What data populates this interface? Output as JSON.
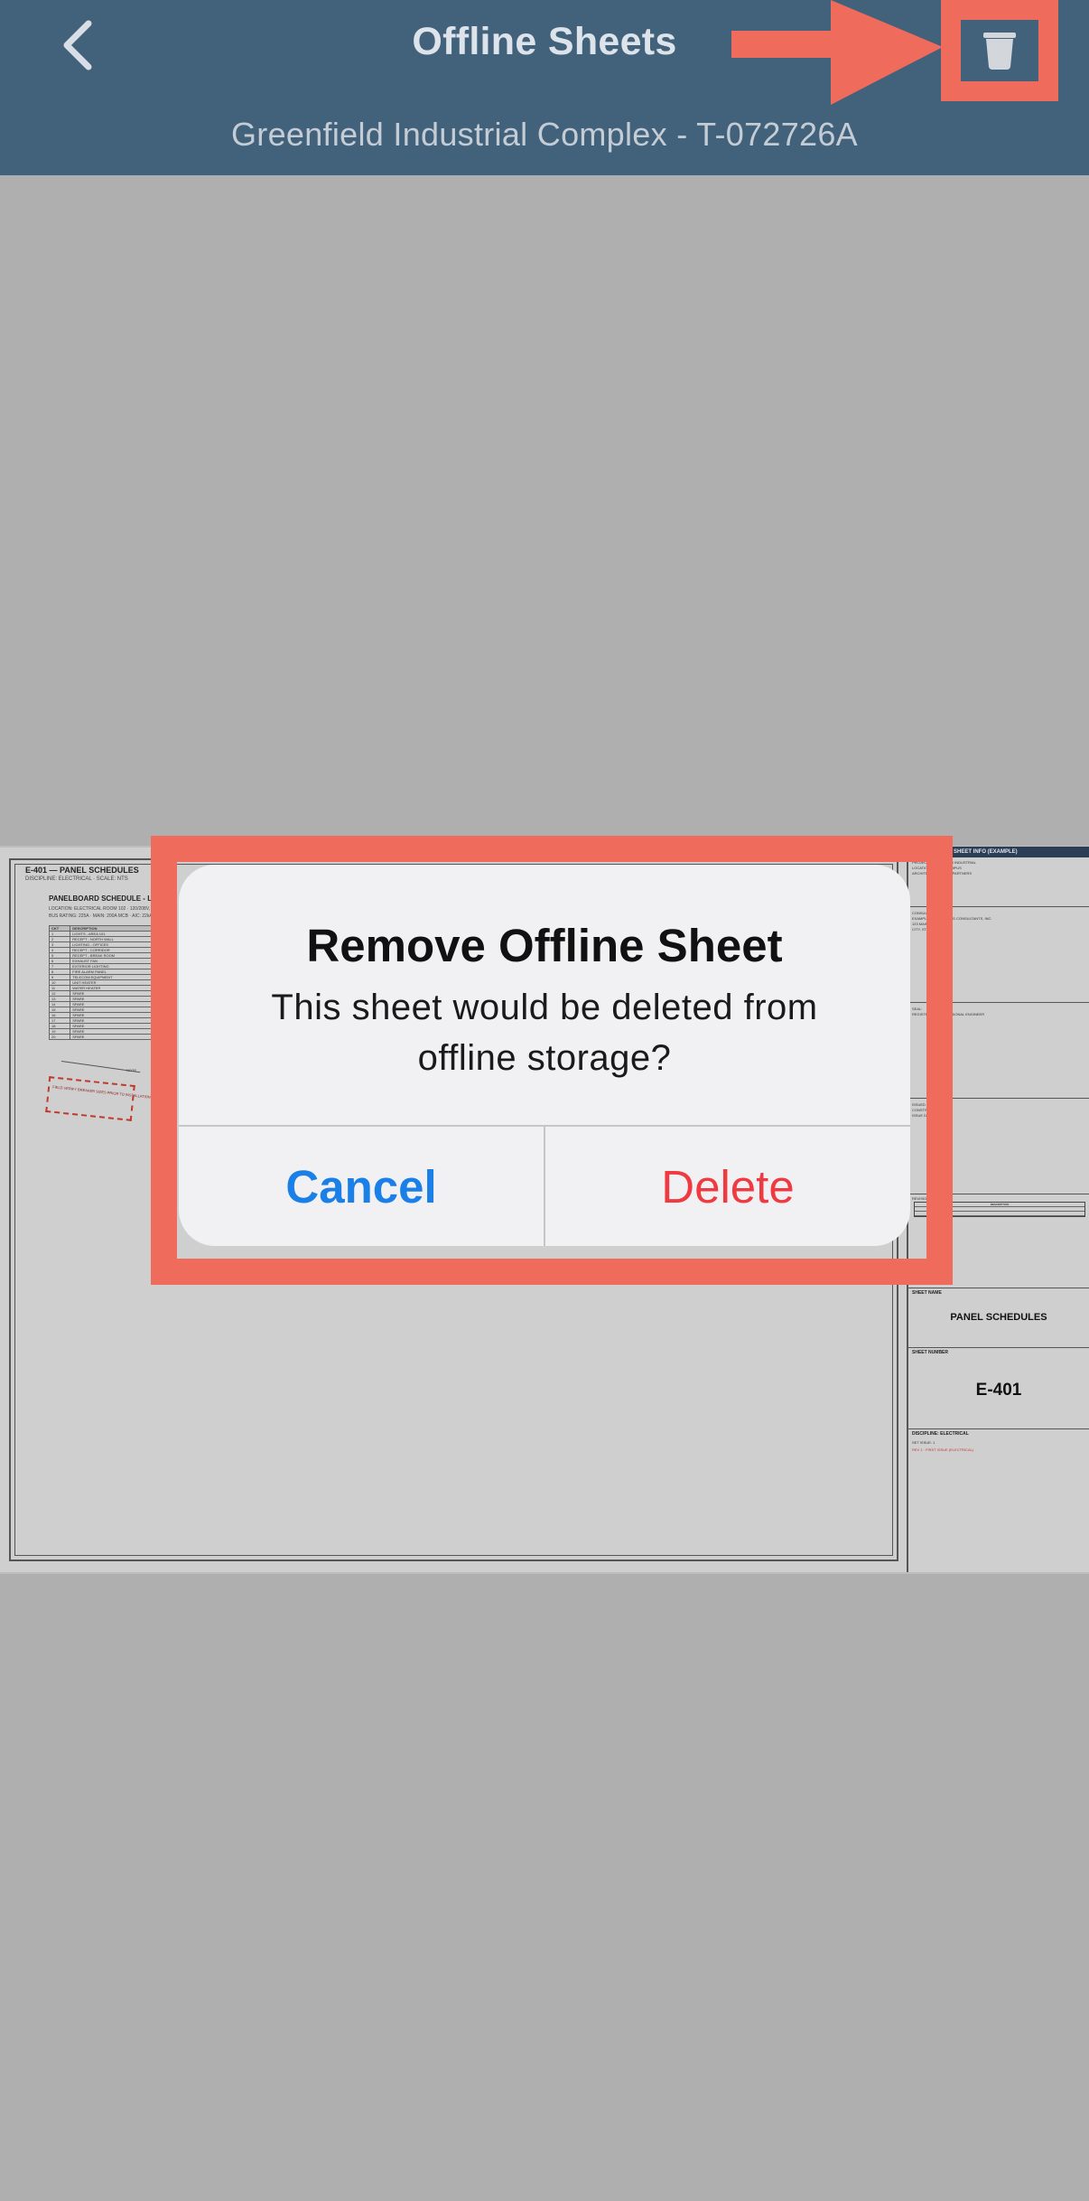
{
  "header": {
    "title": "Offline Sheets",
    "subtitle": "Greenfield Industrial Complex - T-072726A",
    "back_icon": "chevron-left-icon",
    "trash_icon": "trash-icon",
    "bar_color": "#42617b",
    "callout_color": "#ef6b5b"
  },
  "sheet": {
    "id_label": "E-401 — PANEL SCHEDULES",
    "sub_label": "DISCIPLINE: ELECTRICAL · SCALE: NTS",
    "panel_title": "PANELBOARD SCHEDULE - LP-1",
    "panel_meta": [
      "LOCATION: ELECTRICAL ROOM 102 · 120/208V, 3PH, 4W",
      "BUS RATING: 225A · MAIN: 200A MCB · AIC: 22kA"
    ],
    "table_header": [
      "CKT",
      "DESCRIPTION"
    ],
    "rows": [
      "LIGHTS - AREA 101",
      "RECEPT - NORTH WALL",
      "LIGHTING - OFFICES",
      "RECEPT - CORRIDOR",
      "RECEPT - BREAK ROOM",
      "EXHAUST FAN",
      "EXTERIOR LIGHTING",
      "FIRE ALARM PANEL",
      "TELECOM EQUIPMENT",
      "UNIT HEATER",
      "WATER HEATER",
      "SPARE",
      "SPARE",
      "SPARE",
      "SPARE",
      "SPARE",
      "SPARE",
      "SPARE",
      "SPARE",
      "SPARE"
    ],
    "callout": "NOTE",
    "stamp_text": "FIELD VERIFY BREAKER SIZES PRIOR TO INSTALLATION",
    "title_block": {
      "header": "SHEET INFO (EXAMPLE)",
      "project_lines": [
        "PROJECT: GREENFIELD INDUSTRIAL",
        "LOCATION: NORTH CAMPUS",
        "ARCHITECT: EXAMPLE PARTNERS"
      ],
      "consultant_lines": [
        "CONSULTANT:",
        "EXAMPLE ENGINEERING CONSULTANTS, INC.",
        "123 MAIN STREET",
        "CITY, STATE 00000"
      ],
      "seal_label": "SEAL:",
      "seal_note": "REGISTERED PROFESSIONAL ENGINEER",
      "issue_lines": [
        "ISSUED FOR:",
        "CONSTRUCTION",
        "ISSUE DATE: 07/27/26"
      ],
      "revisions_label": "REVISIONS",
      "revisions_col": "DESCRIPTION",
      "sheet_name_label": "SHEET NAME",
      "sheet_name": "PANEL SCHEDULES",
      "sheet_number_label": "SHEET NUMBER",
      "sheet_number": "E-401",
      "discipline_label": "DISCIPLINE: ELECTRICAL",
      "discipline_sub": "SET ISSUE: 1",
      "discipline_red": "REV 1 · FIRST ISSUE (ELECTRICAL)"
    }
  },
  "dialog": {
    "title": "Remove Offline Sheet",
    "message": "This sheet would be deleted from offline storage?",
    "cancel_label": "Cancel",
    "delete_label": "Delete",
    "cancel_color": "#1a80e8",
    "delete_color": "#ef3a42"
  }
}
